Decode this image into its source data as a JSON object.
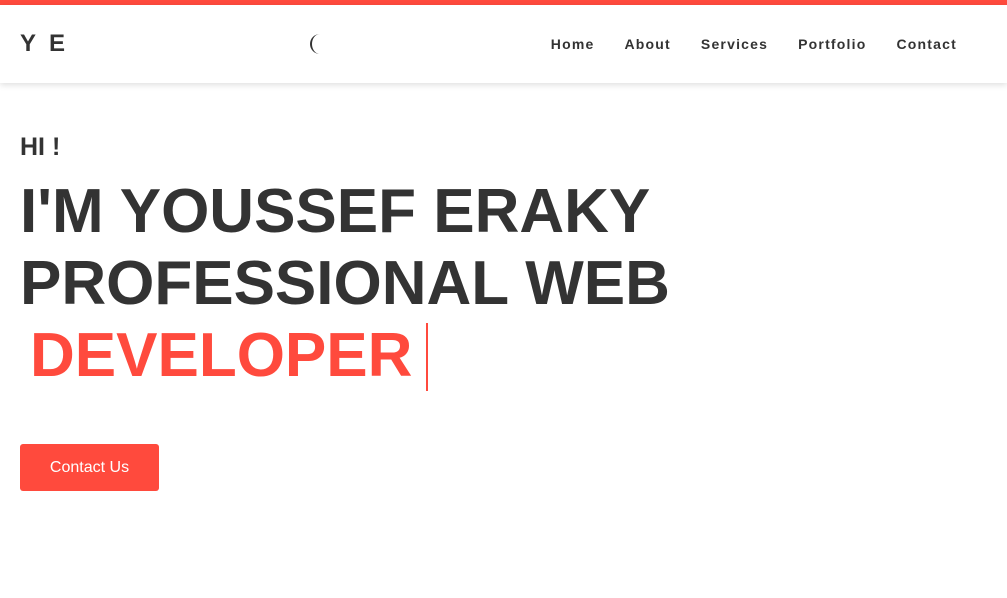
{
  "brand": {
    "logo": "YE",
    "accent_color": "#ff4a3d",
    "text_color": "#333333"
  },
  "header": {
    "theme_toggle_icon": "moon-icon",
    "nav": [
      {
        "label": "Home"
      },
      {
        "label": "About"
      },
      {
        "label": "Services"
      },
      {
        "label": "Portfolio"
      },
      {
        "label": "Contact"
      }
    ]
  },
  "hero": {
    "greeting": "HI !",
    "line1": "I'M YOUSSEF ERAKY",
    "line2": "PROFESSIONAL WEB",
    "role": "DEVELOPER",
    "cta_label": "Contact Us"
  }
}
